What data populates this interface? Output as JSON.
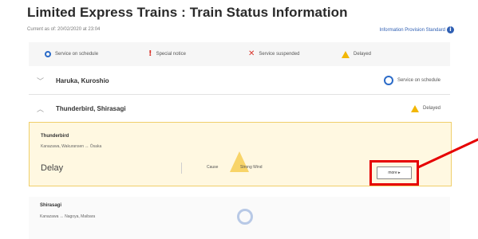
{
  "header": {
    "title": "Limited Express Trains : Train Status Information",
    "current_as_of": "Current as of: 20/02/2020 at 23:04",
    "standard_link": "Information Provision Standard",
    "standard_icon": "info-icon"
  },
  "legend": {
    "items": [
      {
        "label": "Service on schedule",
        "icon": "circle-icon",
        "color": "#2b6bc8"
      },
      {
        "label": "Special notice",
        "icon": "exclamation-icon",
        "color": "#d9342b"
      },
      {
        "label": "Service suspended",
        "icon": "x-icon",
        "color": "#d9342b"
      },
      {
        "label": "Delayed",
        "icon": "triangle-icon",
        "color": "#f2b705"
      }
    ]
  },
  "lines": [
    {
      "name": "Haruka, Kuroshio",
      "status": "Service on schedule",
      "expanded": false
    },
    {
      "name": "Thunderbird, Shirasagi",
      "status": "Delayed",
      "expanded": true
    }
  ],
  "detail": {
    "train": "Thunderbird",
    "route": "Kanazawa, Wakuransen ↔ Ōsaka",
    "status": "Delay",
    "cause_label": "Cause",
    "cause_value": "Strong Wind",
    "more_label": "more ▸"
  },
  "shirasagi": {
    "train": "Shirasagi",
    "route": "Kanazawa ↔ Nagoya, Maibara"
  }
}
